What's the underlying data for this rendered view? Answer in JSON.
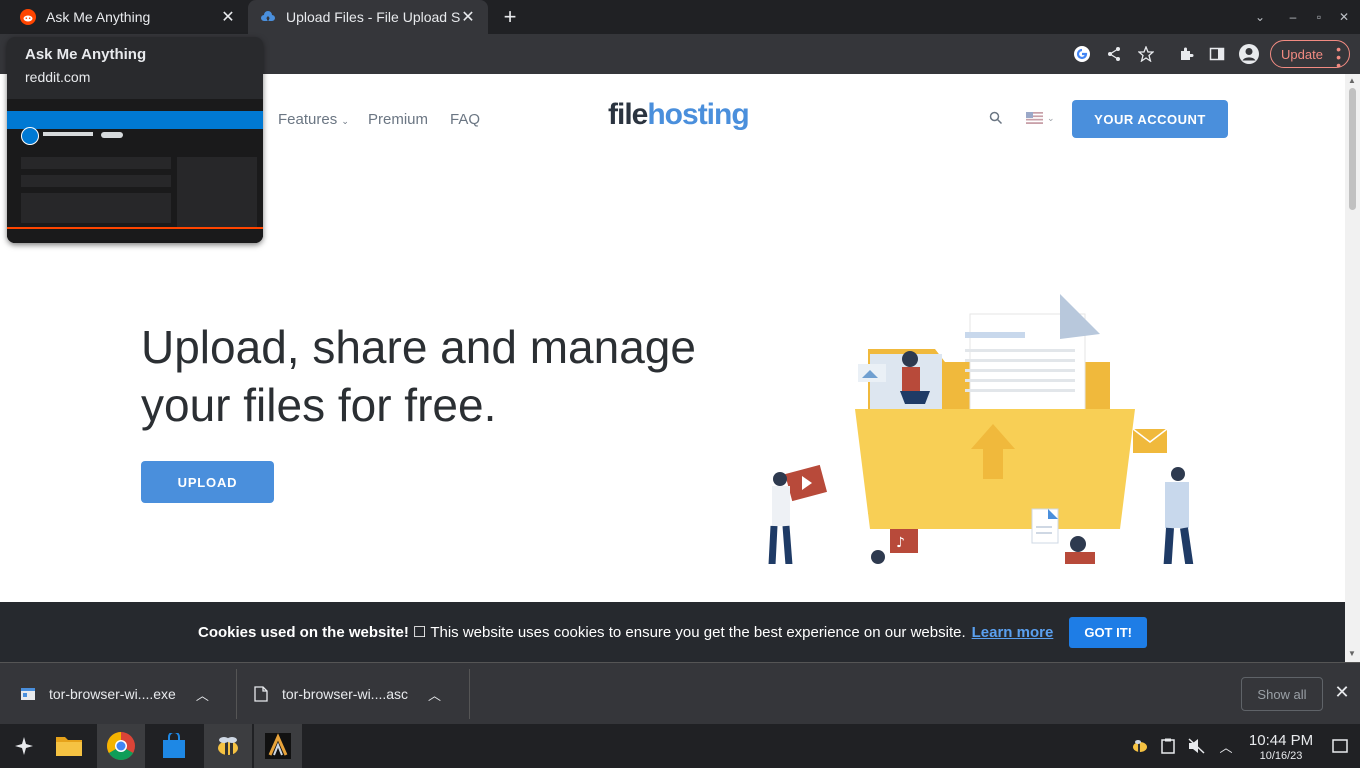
{
  "tabs": [
    {
      "title": "Ask Me Anything",
      "favicon": "reddit-icon"
    },
    {
      "title": "Upload Files - File Upload Script",
      "favicon": "cloud-icon"
    }
  ],
  "tooltip": {
    "title": "Ask Me Anything",
    "domain": "reddit.com"
  },
  "toolbar": {
    "update_label": "Update"
  },
  "site": {
    "nav": [
      "Features",
      "Premium",
      "FAQ"
    ],
    "logo": {
      "part1": "file",
      "part2": "hosting"
    },
    "account_label": "YOUR ACCOUNT",
    "hero_title": "Upload, share and manage your files for free.",
    "upload_label": "UPLOAD",
    "language": "en-US"
  },
  "cookie": {
    "heading": "Cookies used on the website!",
    "checkbox": "☐",
    "text": "This website uses cookies to ensure you get the best experience on our website.",
    "learn": "Learn more",
    "ok": "GOT IT!"
  },
  "downloads": {
    "items": [
      {
        "name": "tor-browser-wi....exe"
      },
      {
        "name": "tor-browser-wi....asc"
      }
    ],
    "show_all": "Show all"
  },
  "taskbar": {
    "time": "10:44 PM",
    "date": "10/16/23"
  },
  "colors": {
    "accent": "#4a8fdc",
    "cookie_button": "#1e7de6",
    "update": "#f28b82"
  }
}
